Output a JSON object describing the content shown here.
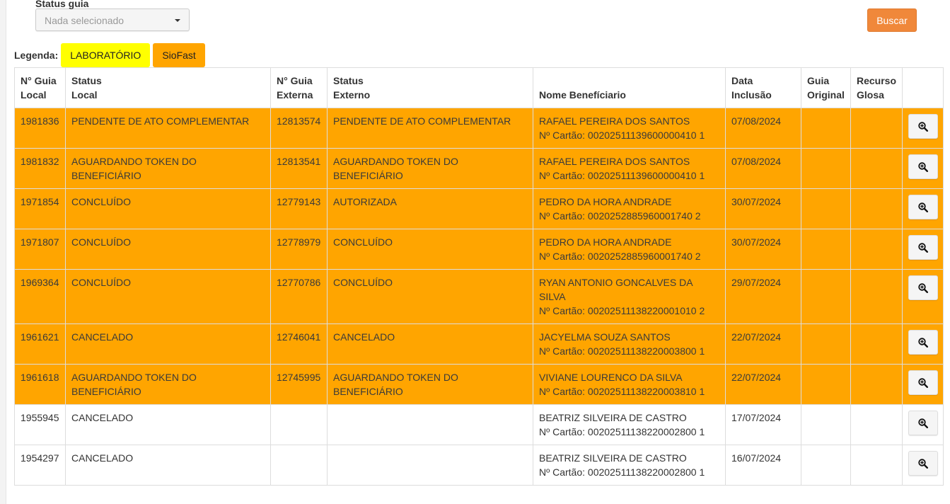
{
  "filters": {
    "status_label": "Status guia",
    "status_placeholder": "Nada selecionado",
    "search_button": "Buscar"
  },
  "legend": {
    "label": "Legenda:",
    "items": [
      {
        "label": "LABORATÓRIO",
        "color": "#ffff00"
      },
      {
        "label": "SioFast",
        "color": "#ffa500"
      }
    ]
  },
  "table": {
    "headers": [
      [
        "N° Guia",
        "Local"
      ],
      [
        "Status",
        "Local"
      ],
      [
        "N° Guia",
        "Externa"
      ],
      [
        "Status",
        "Externo"
      ],
      [
        "",
        "Nome Benefíciario"
      ],
      [
        "Data",
        "Inclusão"
      ],
      [
        "Guia",
        "Original"
      ],
      [
        "Recurso",
        "Glosa"
      ],
      [
        "",
        ""
      ]
    ],
    "rows": [
      {
        "type": "siofast",
        "guia_local": "1981836",
        "status_local": "PENDENTE DE ATO COMPLEMENTAR",
        "guia_externa": "12813574",
        "status_externo": "PENDENTE DE ATO COMPLEMENTAR",
        "nome": "RAFAEL PEREIRA DOS SANTOS",
        "cartao": "Nº Cartão: 00202511139600000410 1",
        "data": "07/08/2024"
      },
      {
        "type": "siofast",
        "guia_local": "1981832",
        "status_local": "AGUARDANDO TOKEN DO BENEFICIÁRIO",
        "guia_externa": "12813541",
        "status_externo": "AGUARDANDO TOKEN DO BENEFICIÁRIO",
        "nome": "RAFAEL PEREIRA DOS SANTOS",
        "cartao": "Nº Cartão: 00202511139600000410 1",
        "data": "07/08/2024"
      },
      {
        "type": "siofast",
        "guia_local": "1971854",
        "status_local": "CONCLUÍDO",
        "guia_externa": "12779143",
        "status_externo": "AUTORIZADA",
        "nome": "PEDRO DA HORA ANDRADE",
        "cartao": "Nº Cartão: 0020252885960001740 2",
        "data": "30/07/2024"
      },
      {
        "type": "siofast",
        "guia_local": "1971807",
        "status_local": "CONCLUÍDO",
        "guia_externa": "12778979",
        "status_externo": "CONCLUÍDO",
        "nome": "PEDRO DA HORA ANDRADE",
        "cartao": "Nº Cartão: 0020252885960001740 2",
        "data": "30/07/2024"
      },
      {
        "type": "siofast",
        "guia_local": "1969364",
        "status_local": "CONCLUÍDO",
        "guia_externa": "12770786",
        "status_externo": "CONCLUÍDO",
        "nome": "RYAN ANTONIO GONCALVES DA SILVA",
        "cartao": "Nº Cartão: 00202511138220001010 2",
        "data": "29/07/2024"
      },
      {
        "type": "siofast",
        "guia_local": "1961621",
        "status_local": "CANCELADO",
        "guia_externa": "12746041",
        "status_externo": "CANCELADO",
        "nome": "JACYELMA SOUZA SANTOS",
        "cartao": "Nº Cartão: 00202511138220003800 1",
        "data": "22/07/2024"
      },
      {
        "type": "siofast",
        "guia_local": "1961618",
        "status_local": "AGUARDANDO TOKEN DO BENEFICIÁRIO",
        "guia_externa": "12745995",
        "status_externo": "AGUARDANDO TOKEN DO BENEFICIÁRIO",
        "nome": "VIVIANE LOURENCO DA SILVA",
        "cartao": "Nº Cartão: 00202511138220003810 1",
        "data": "22/07/2024"
      },
      {
        "type": "normal",
        "guia_local": "1955945",
        "status_local": "CANCELADO",
        "guia_externa": "",
        "status_externo": "",
        "nome": "BEATRIZ SILVEIRA DE CASTRO",
        "cartao": "Nº Cartão: 00202511138220002800 1",
        "data": "17/07/2024"
      },
      {
        "type": "normal",
        "guia_local": "1954297",
        "status_local": "CANCELADO",
        "guia_externa": "",
        "status_externo": "",
        "nome": "BEATRIZ SILVEIRA DE CASTRO",
        "cartao": "Nº Cartão: 00202511138220002800 1",
        "data": "16/07/2024"
      }
    ]
  }
}
